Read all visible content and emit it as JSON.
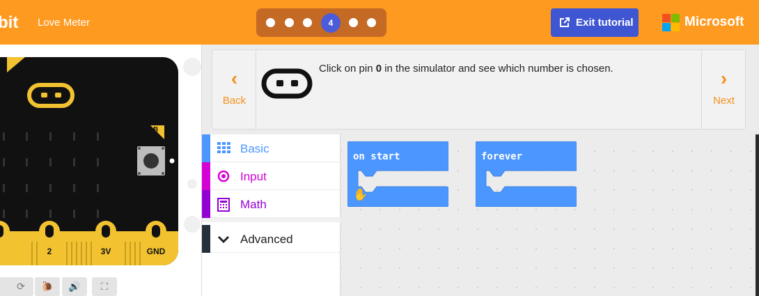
{
  "header": {
    "brand": "bit",
    "project_name": "Love Meter",
    "current_step": "4",
    "exit_label": "Exit tutorial",
    "company": "Microsoft",
    "colors": {
      "header": "#ff9a20",
      "accent": "#3f56d3"
    }
  },
  "simulator": {
    "button_b": "B",
    "pins": [
      "2",
      "3V",
      "GND"
    ],
    "controls": [
      "restart-icon",
      "slow-mo-icon",
      "mute-icon",
      "fullscreen-icon"
    ]
  },
  "tutorial": {
    "back_label": "Back",
    "next_label": "Next",
    "text_before": "Click on pin ",
    "text_bold": "0",
    "text_after": " in the simulator and see which number is chosen."
  },
  "toolbox": {
    "categories": [
      {
        "label": "Basic",
        "color": "#4c97ff"
      },
      {
        "label": "Input",
        "color": "#d400d4"
      },
      {
        "label": "Math",
        "color": "#9400d3"
      }
    ],
    "advanced_label": "Advanced"
  },
  "workspace": {
    "blocks": [
      {
        "label": "on start"
      },
      {
        "label": "forever"
      }
    ]
  }
}
